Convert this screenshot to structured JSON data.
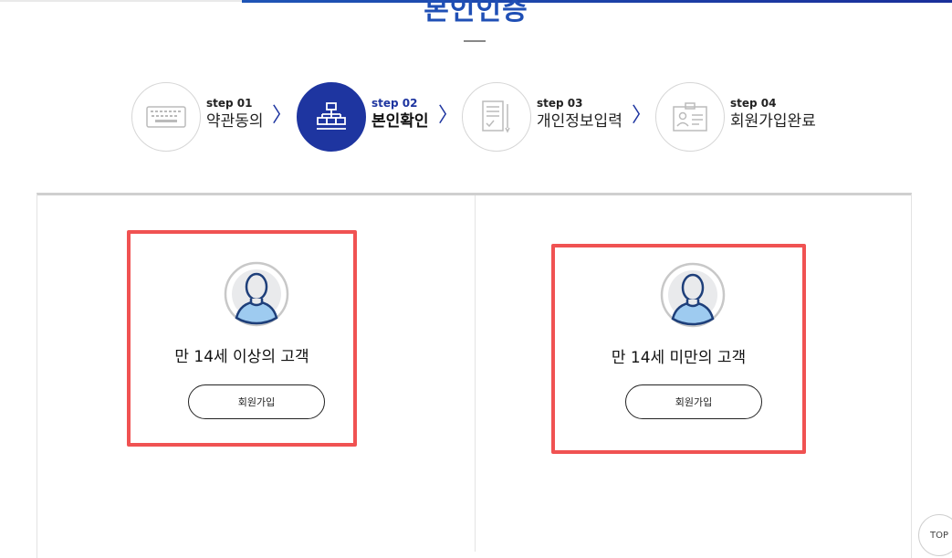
{
  "page": {
    "title": "본인인증"
  },
  "steps": [
    {
      "num": "step 01",
      "label": "약관동의",
      "icon": "keyboard-icon",
      "active": false
    },
    {
      "num": "step 02",
      "label": "본인확인",
      "icon": "org-chart-icon",
      "active": true
    },
    {
      "num": "step 03",
      "label": "개인정보입력",
      "icon": "document-pen-icon",
      "active": false
    },
    {
      "num": "step 04",
      "label": "회원가입완료",
      "icon": "id-card-icon",
      "active": false
    }
  ],
  "options": [
    {
      "title": "만 14세 이상의 고객",
      "button": "회원가입",
      "icon": "user-avatar-icon"
    },
    {
      "title": "만 14세 미만의 고객",
      "button": "회원가입",
      "icon": "user-avatar-icon"
    }
  ],
  "top_button": {
    "label": "TOP"
  },
  "colors": {
    "brand_blue": "#1e35a0",
    "title_blue": "#1f4fb5",
    "highlight_red": "#f05252",
    "avatar_fill": "#9ecbf0",
    "avatar_stroke": "#1e3f7a"
  },
  "arrow_glyph": "〉"
}
